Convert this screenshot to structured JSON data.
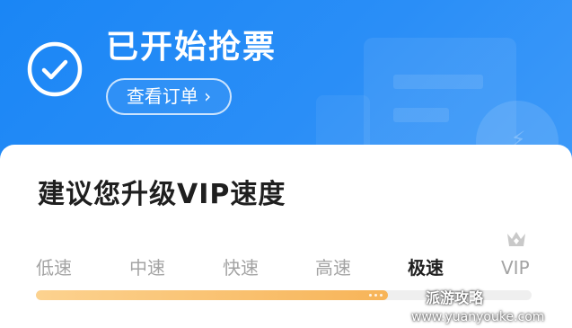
{
  "header": {
    "title": "已开始抢票",
    "order_button": "查看订单 ›"
  },
  "upgrade": {
    "title": "建议您升级VIP速度",
    "speeds": [
      "低速",
      "中速",
      "快速",
      "高速",
      "极速",
      "VIP"
    ],
    "selected": "极速",
    "progress_fraction": 0.71
  },
  "watermark": {
    "name": "派游攻略",
    "url": "www.yuanyouke.com"
  },
  "colors": {
    "header_blue": "#1a86f5",
    "progress_orange": "#f7b458",
    "muted_text": "#a3a3a3"
  },
  "icons": {
    "status": "check-circle-icon",
    "vip": "crown-icon"
  }
}
